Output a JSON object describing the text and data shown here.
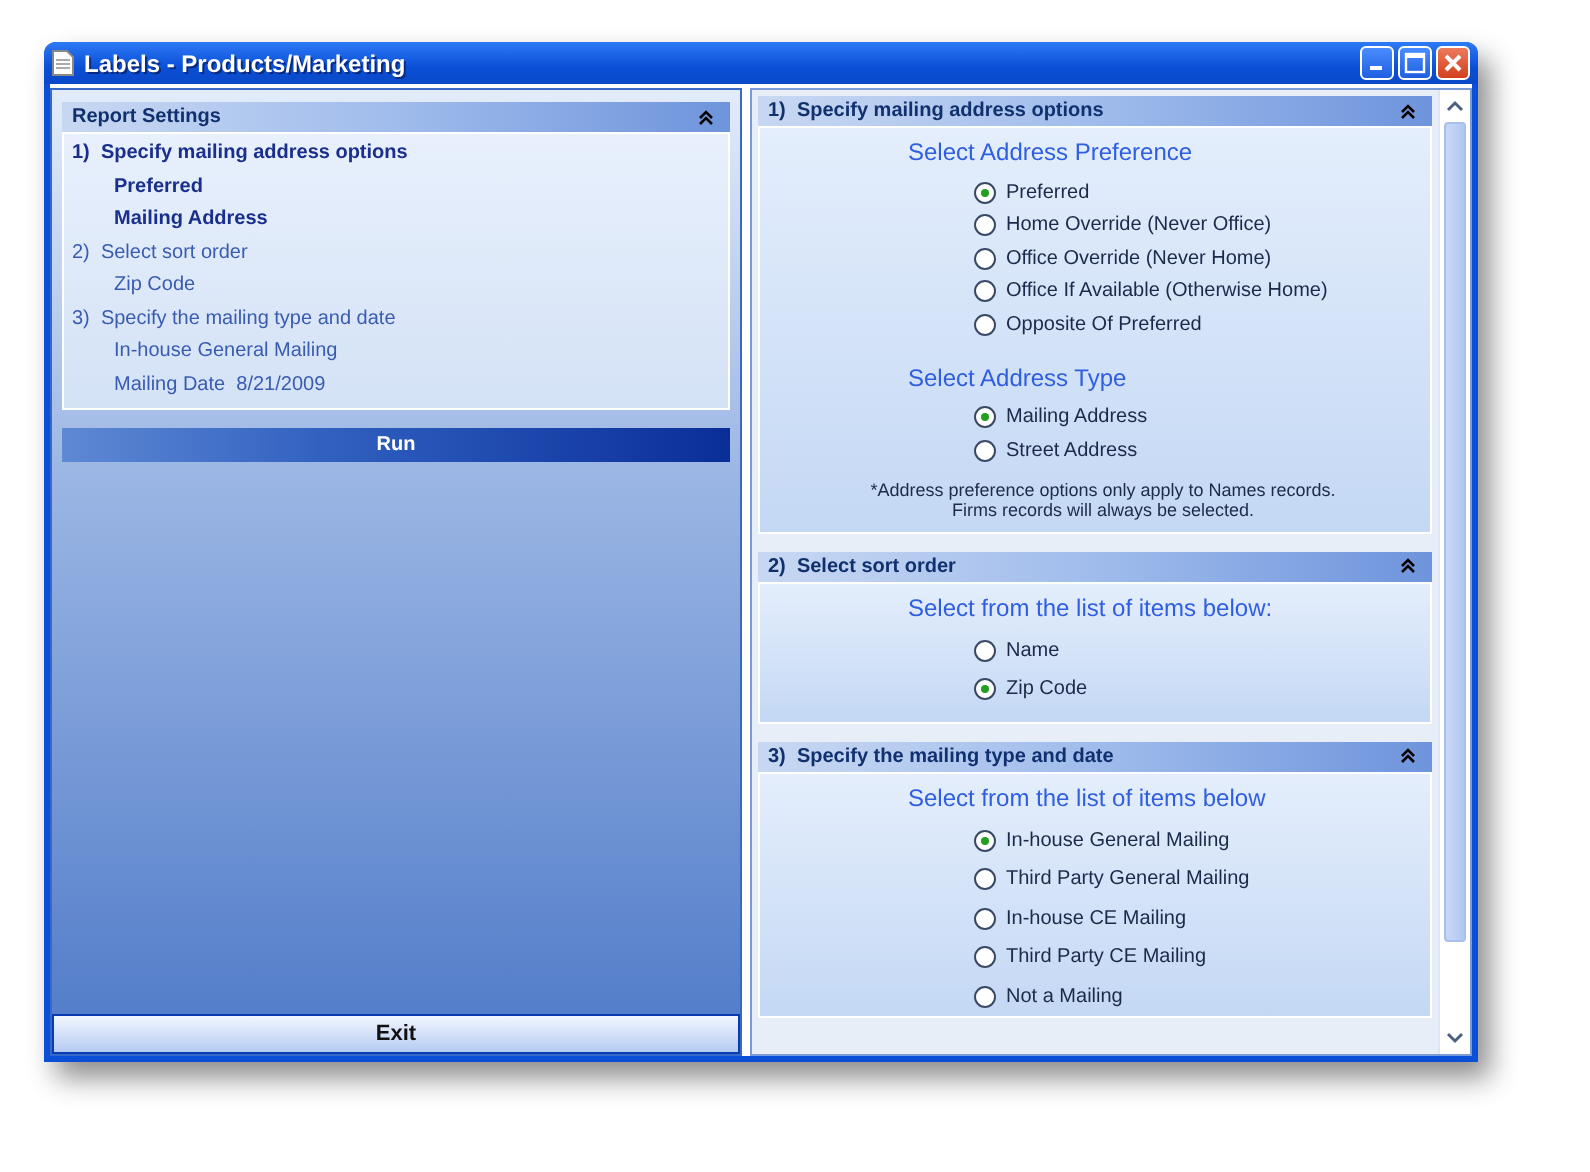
{
  "window": {
    "title": "Labels - Products/Marketing"
  },
  "summary": {
    "title": "Report Settings",
    "items": [
      {
        "text": "1)  Specify mailing address options",
        "kind": "step",
        "highlighted": true
      },
      {
        "text": "Preferred",
        "kind": "value",
        "highlighted": true
      },
      {
        "text": "Mailing Address",
        "kind": "value",
        "highlighted": true
      },
      {
        "text": "2)  Select sort order",
        "kind": "step",
        "highlighted": false
      },
      {
        "text": "Zip Code",
        "kind": "value",
        "highlighted": false
      },
      {
        "text": "3)  Specify the mailing type and date",
        "kind": "step",
        "highlighted": false
      },
      {
        "text": "In-house General Mailing",
        "kind": "value",
        "highlighted": false
      },
      {
        "text": "Mailing Date  8/21/2009",
        "kind": "value",
        "highlighted": false
      }
    ]
  },
  "run_button": "Run",
  "exit_button": "Exit",
  "sections": [
    {
      "title": "1)  Specify mailing address options",
      "groups": [
        {
          "heading": "Select Address Preference",
          "options": [
            {
              "label": "Preferred",
              "selected": true
            },
            {
              "label": "Home Override (Never Office)",
              "selected": false
            },
            {
              "label": "Office Override (Never Home)",
              "selected": false
            },
            {
              "label": "Office If Available (Otherwise Home)",
              "selected": false
            },
            {
              "label": "Opposite Of Preferred",
              "selected": false
            }
          ]
        },
        {
          "heading": "Select Address Type",
          "options": [
            {
              "label": "Mailing Address",
              "selected": true
            },
            {
              "label": "Street Address",
              "selected": false
            }
          ]
        }
      ],
      "note": "*Address preference options only apply to Names records.\nFirms records will always be selected."
    },
    {
      "title": "2)  Select sort order",
      "groups": [
        {
          "heading": "Select from the list of items below:",
          "options": [
            {
              "label": "Name",
              "selected": false
            },
            {
              "label": "Zip Code",
              "selected": true
            }
          ]
        }
      ]
    },
    {
      "title": "3)  Specify the mailing type and date",
      "groups": [
        {
          "heading": "Select from the list of items below",
          "options": [
            {
              "label": "In-house General Mailing",
              "selected": true
            },
            {
              "label": "Third Party General Mailing",
              "selected": false
            },
            {
              "label": "In-house CE Mailing",
              "selected": false
            },
            {
              "label": "Third Party CE Mailing",
              "selected": false
            },
            {
              "label": "Not a Mailing",
              "selected": false
            }
          ]
        }
      ]
    }
  ]
}
